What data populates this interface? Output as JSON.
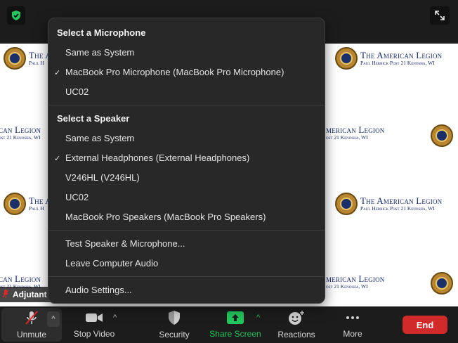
{
  "menu": {
    "mic_heading": "Select a Microphone",
    "mic_items": [
      {
        "label": "Same as System",
        "checked": false
      },
      {
        "label": "MacBook Pro Microphone (MacBook Pro Microphone)",
        "checked": true
      },
      {
        "label": "UC02",
        "checked": false
      }
    ],
    "speaker_heading": "Select a Speaker",
    "speaker_items": [
      {
        "label": "Same as System",
        "checked": false
      },
      {
        "label": "External Headphones (External Headphones)",
        "checked": true
      },
      {
        "label": "V246HL (V246HL)",
        "checked": false
      },
      {
        "label": "UC02",
        "checked": false
      },
      {
        "label": "MacBook Pro Speakers (MacBook Pro Speakers)",
        "checked": false
      }
    ],
    "test_label": "Test Speaker & Microphone...",
    "leave_label": "Leave Computer Audio",
    "settings_label": "Audio Settings...",
    "check_glyph": "✓"
  },
  "background": {
    "title": "The American Legion",
    "title_partial": "can Legion",
    "title_partial_short": "The A",
    "title_right_partial": "merican Legion",
    "subtitle": "Paul Herrick Post 21 Kenosha, WI",
    "subtitle_partial": "ost 21 Kenosha, WI",
    "subtitle_partial_short": "Paul H",
    "subtitle_right_partial": "ost 21 Kenosha, WI"
  },
  "participant": {
    "name": "Adjutant"
  },
  "toolbar": {
    "unmute": "Unmute",
    "stop_video": "Stop Video",
    "security": "Security",
    "share_screen": "Share Screen",
    "reactions": "Reactions",
    "more": "More",
    "end": "End",
    "caret": "^"
  },
  "colors": {
    "accent_green": "#22c55e",
    "end_red": "#d02a2a",
    "legion_blue": "#16286b"
  }
}
